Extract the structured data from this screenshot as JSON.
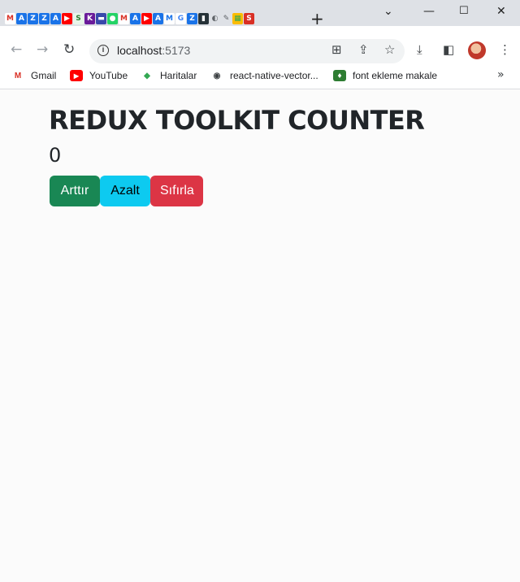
{
  "browser": {
    "tab_icons": [
      {
        "glyph": "M",
        "bg": "#ffffff",
        "fg": "#d93025"
      },
      {
        "glyph": "A",
        "bg": "#1a73e8",
        "fg": "#ffffff"
      },
      {
        "glyph": "Z",
        "bg": "#1a73e8",
        "fg": "#ffffff"
      },
      {
        "glyph": "Z",
        "bg": "#1a73e8",
        "fg": "#ffffff"
      },
      {
        "glyph": "A",
        "bg": "#1a73e8",
        "fg": "#ffffff"
      },
      {
        "glyph": "▶",
        "bg": "#ff0000",
        "fg": "#ffffff"
      },
      {
        "glyph": "S",
        "bg": "#e8f5e9",
        "fg": "#2e7d32"
      },
      {
        "glyph": "K",
        "bg": "#6a1b9a",
        "fg": "#ffffff"
      },
      {
        "glyph": "▬",
        "bg": "#3949ab",
        "fg": "#ffffff"
      },
      {
        "glyph": "●",
        "bg": "#25d366",
        "fg": "#ffffff"
      },
      {
        "glyph": "M",
        "bg": "#ffffff",
        "fg": "#d93025"
      },
      {
        "glyph": "A",
        "bg": "#1a73e8",
        "fg": "#ffffff"
      },
      {
        "glyph": "▶",
        "bg": "#ff0000",
        "fg": "#ffffff"
      },
      {
        "glyph": "A",
        "bg": "#1a73e8",
        "fg": "#ffffff"
      },
      {
        "glyph": "M",
        "bg": "#ffffff",
        "fg": "#1a73e8"
      },
      {
        "glyph": "G",
        "bg": "#ffffff",
        "fg": "#4285f4"
      },
      {
        "glyph": "Z",
        "bg": "#1a73e8",
        "fg": "#ffffff"
      },
      {
        "glyph": "▮",
        "bg": "#263238",
        "fg": "#ffffff"
      },
      {
        "glyph": "◐",
        "bg": "#dee1e6",
        "fg": "#5f6368"
      },
      {
        "glyph": "✎",
        "bg": "#dee1e6",
        "fg": "#5f6368"
      },
      {
        "glyph": "▦",
        "bg": "#fbbc04",
        "fg": "#34a853"
      },
      {
        "glyph": "S",
        "bg": "#d93025",
        "fg": "#ffffff"
      }
    ],
    "new_tab_icon": "plus-icon",
    "url_host": "localhost",
    "url_port": ":5173",
    "bookmarks": [
      {
        "label": "Gmail",
        "icon": "gmail-icon",
        "glyph": "M",
        "color": "#d93025"
      },
      {
        "label": "YouTube",
        "icon": "youtube-icon",
        "glyph": "▶",
        "color": "#ff0000"
      },
      {
        "label": "Haritalar",
        "icon": "maps-icon",
        "glyph": "◆",
        "color": "#34a853"
      },
      {
        "label": "react-native-vector...",
        "icon": "globe-icon",
        "glyph": "◉",
        "color": "#3c4043"
      },
      {
        "label": "font ekleme makale",
        "icon": "bookmark-page-icon",
        "glyph": "♦",
        "color": "#2e7d32"
      }
    ]
  },
  "app": {
    "title": "REDUX TOOLKIT COUNTER",
    "count": "0",
    "buttons": {
      "increment": "Arttır",
      "decrement": "Azalt",
      "reset": "Sıfırla"
    },
    "colors": {
      "increment": "#198754",
      "decrement": "#0dcaf0",
      "reset": "#dc3545"
    }
  }
}
